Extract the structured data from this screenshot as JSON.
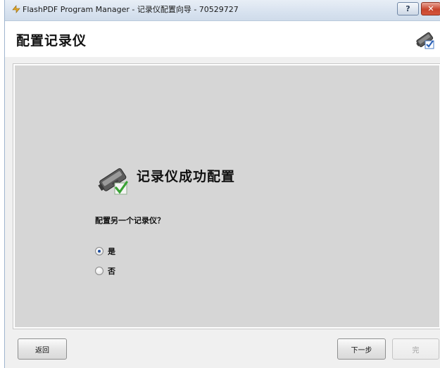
{
  "window": {
    "title": "FlashPDF Program Manager - 记录仪配置向导 - 70529727",
    "help_label": "?",
    "close_label": "✕"
  },
  "header": {
    "title": "配置记录仪",
    "icon": "logger-config-icon"
  },
  "main": {
    "success_message": "记录仪成功配置",
    "success_icon": "logger-success-icon",
    "question": "配置另一个记录仪？",
    "options": [
      {
        "label": "是",
        "checked": true
      },
      {
        "label": "否",
        "checked": false
      }
    ]
  },
  "footer": {
    "back_label": "返回",
    "next_label": "下一步",
    "finish_label": "完",
    "finish_enabled": false
  },
  "colors": {
    "panel_bg": "#d6d6d6",
    "title_bar": "#d7e2ef",
    "close_button": "#c7442c",
    "check_green": "#3aa335"
  }
}
